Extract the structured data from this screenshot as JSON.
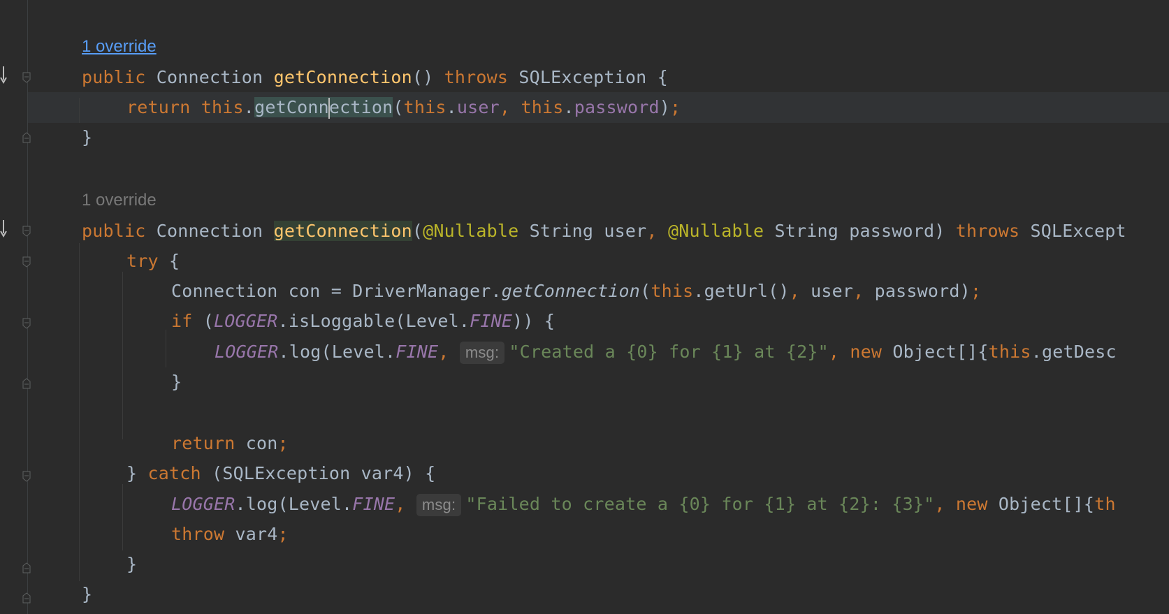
{
  "hints": {
    "override_1": "1 override",
    "override_2": "1 override"
  },
  "code": {
    "l1": {
      "public": "public",
      "type": "Connection",
      "name": "getConnection",
      "sig": "()",
      "throws": "throws",
      "exc": "SQLException",
      "brace": "{"
    },
    "l2": {
      "ret": "return",
      "this1": "this",
      "dot1": ".",
      "call_a": "getConn",
      "call_b": "ection",
      "paren": "(",
      "this2": "this",
      "dot2": ".",
      "user": "user",
      "comma": ",",
      "this3": "this",
      "dot3": ".",
      "password": "password",
      "close": ")",
      "semi": ";"
    },
    "l3": "}",
    "l4": {
      "public": "public",
      "type": "Connection",
      "name": "getConnection",
      "paren": "(",
      "ann1": "@Nullable",
      "p1": "String user",
      "comma": ",",
      "ann2": "@Nullable",
      "p2": "String password)",
      "throws": "throws",
      "exc": "SQLExcept"
    },
    "l5": {
      "try": "try",
      "brace": "{"
    },
    "l6": {
      "text": "Connection con = DriverManager.",
      "call": "getConnection",
      "paren": "(",
      "this": "this",
      "rest1": ".getUrl()",
      "comma1": ",",
      "user": " user",
      "comma2": ",",
      "rest2": " password)",
      "semi": ";"
    },
    "l7": {
      "if": "if",
      "open": "(",
      "logger": "LOGGER",
      "rest1": ".isLoggable(Level.",
      "fine": "FINE",
      "rest2": ")) {"
    },
    "l8": {
      "logger": "LOGGER",
      "rest1": ".log(Level.",
      "fine": "FINE",
      "comma": ",",
      "hint": "msg:",
      "str": "\"Created a {0} for {1} at {2}\"",
      "comma2": ",",
      "new": "new",
      "rest2": " Object[]{",
      "this": "this",
      "rest3": ".getDesc"
    },
    "l9": "}",
    "l10": {
      "ret": "return",
      "rest": " con",
      "semi": ";"
    },
    "l11": {
      "close": "}",
      "catch": "catch",
      "rest": "(SQLException var4) {"
    },
    "l12": {
      "logger": "LOGGER",
      "rest1": ".log(Level.",
      "fine": "FINE",
      "comma": ",",
      "hint": "msg:",
      "str": "\"Failed to create a {0} for {1} at {2}: {3}\"",
      "comma2": ",",
      "new": "new",
      "rest2": " Object[]{",
      "this": "th"
    },
    "l13": {
      "throw": "throw",
      "rest": " var4",
      "semi": ";"
    },
    "l14": "}",
    "l15": "}"
  },
  "icons": {
    "override": "override-arrow-icon",
    "fold_open": "fold-start-icon",
    "fold_end": "fold-end-icon"
  },
  "colors": {
    "background": "#2b2b2b",
    "keyword": "#cc7832",
    "method": "#ffc66d",
    "field": "#9876aa",
    "annotation": "#bbb529",
    "string": "#6a8759",
    "default": "#a9b7c6"
  }
}
